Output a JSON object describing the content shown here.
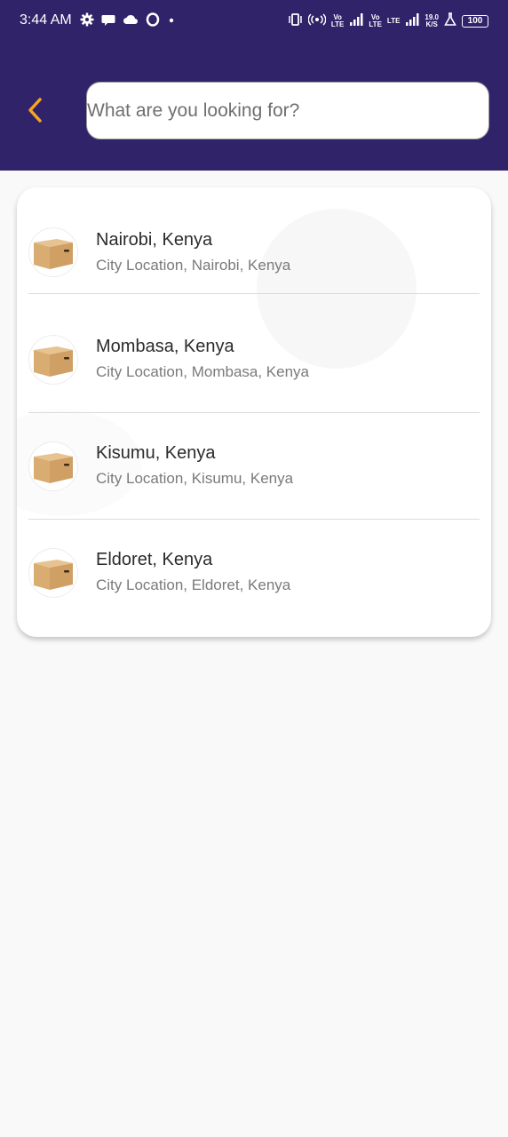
{
  "status_bar": {
    "time": "3:44 AM",
    "left_icons": [
      "gear-icon",
      "chat-icon",
      "cloud-icon",
      "opera-icon",
      "dot-icon"
    ],
    "right_icons": [
      "vibrate-icon",
      "hotspot-icon",
      "volte-icon",
      "signal-icon",
      "lte-icon",
      "signal-icon",
      "speed-icon",
      "flask-icon"
    ],
    "volte_label_top": "Vo",
    "volte_label_bottom": "LTE",
    "lte_label_top": "LTE",
    "speed_value": "19.0",
    "speed_unit": "K/S",
    "battery_level": "100"
  },
  "header": {
    "back_icon": "chevron-left-icon",
    "back_color": "#f5a623",
    "background": "#30236a"
  },
  "search": {
    "placeholder": "What are you looking for?",
    "value": ""
  },
  "locations": [
    {
      "title": "Nairobi, Kenya",
      "subtitle": "City Location, Nairobi, Kenya",
      "icon": "box-icon"
    },
    {
      "title": "Mombasa, Kenya",
      "subtitle": "City Location, Mombasa, Kenya",
      "icon": "box-icon"
    },
    {
      "title": "Kisumu, Kenya",
      "subtitle": "City Location, Kisumu, Kenya",
      "icon": "box-icon"
    },
    {
      "title": "Eldoret, Kenya",
      "subtitle": "City Location, Eldoret, Kenya",
      "icon": "box-icon"
    }
  ]
}
